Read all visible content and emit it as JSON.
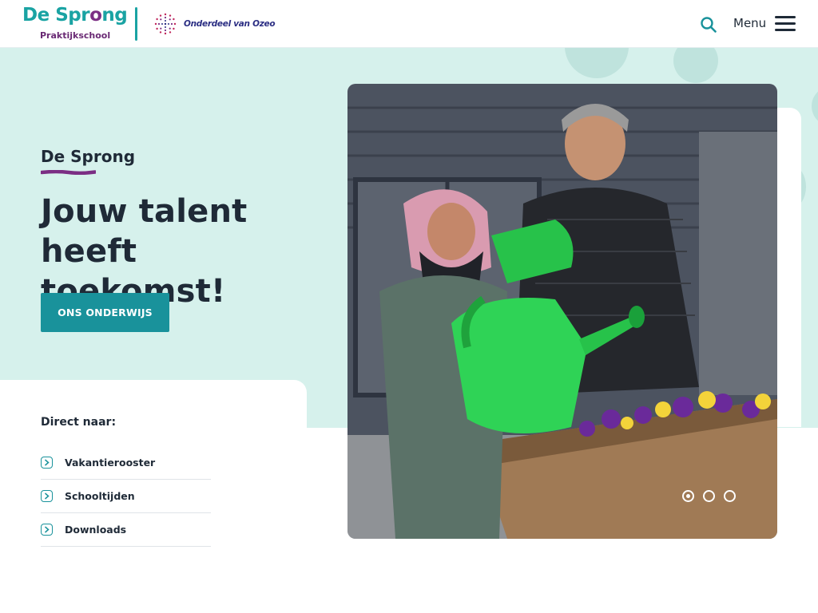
{
  "header": {
    "logo_main_pre": "De Spr",
    "logo_main_o": "o",
    "logo_main_post": "ng",
    "logo_sub": "Praktijkschool",
    "partner_text": "Onderdeel van Ozeo",
    "menu_label": "Menu"
  },
  "hero": {
    "kicker": "De Sprong",
    "title": "Jouw talent heeft toekomst!",
    "cta_label": "ONS ONDERWIJS",
    "slides_count": 3,
    "active_slide": 1
  },
  "direct": {
    "title": "Direct naar:",
    "items": [
      {
        "label": "Vakantierooster"
      },
      {
        "label": "Schooltijden"
      },
      {
        "label": "Downloads"
      }
    ]
  },
  "colors": {
    "brand_teal": "#19929b",
    "brand_purple": "#7b2e84",
    "hero_bg": "#d6f1ec",
    "text_dark": "#1f2a37"
  },
  "icons": {
    "search": "search-icon",
    "menu": "hamburger-icon",
    "chevron": "chevron-right-icon"
  }
}
